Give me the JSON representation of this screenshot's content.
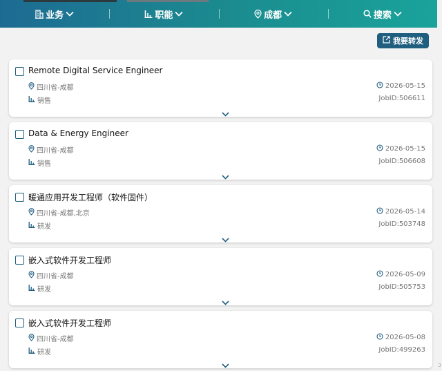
{
  "nav": {
    "items": [
      {
        "label": "业务",
        "icon": "building-icon"
      },
      {
        "label": "职能",
        "icon": "bar-chart-icon"
      },
      {
        "label": "成都",
        "icon": "location-pin-icon"
      },
      {
        "label": "搜索",
        "icon": "search-icon"
      }
    ]
  },
  "forward_button": {
    "label": "我要转发",
    "icon": "share-icon"
  },
  "jobs": [
    {
      "title": "Remote Digital Service Engineer",
      "location": "四川省-成都",
      "category": "销售",
      "date": "2026-05-15",
      "job_id": "JobID:506611"
    },
    {
      "title": "Data & Energy Engineer",
      "location": "四川省-成都",
      "category": "销售",
      "date": "2026-05-15",
      "job_id": "JobID:506608"
    },
    {
      "title": "暖通应用开发工程师（软件固件）",
      "location": "四川省-成都,北京",
      "category": "研发",
      "date": "2026-05-14",
      "job_id": "JobID:503748"
    },
    {
      "title": "嵌入式软件开发工程师",
      "location": "四川省-成都",
      "category": "研发",
      "date": "2026-05-09",
      "job_id": "JobID:505753"
    },
    {
      "title": "嵌入式软件开发工程师",
      "location": "四川省-成都",
      "category": "研发",
      "date": "2026-05-08",
      "job_id": "JobID:499263"
    }
  ],
  "colors": {
    "accent": "#1f5e7f",
    "nav_start": "#1d6b93",
    "nav_end": "#1aa39b",
    "meta_icon": "#1f5e7f"
  }
}
